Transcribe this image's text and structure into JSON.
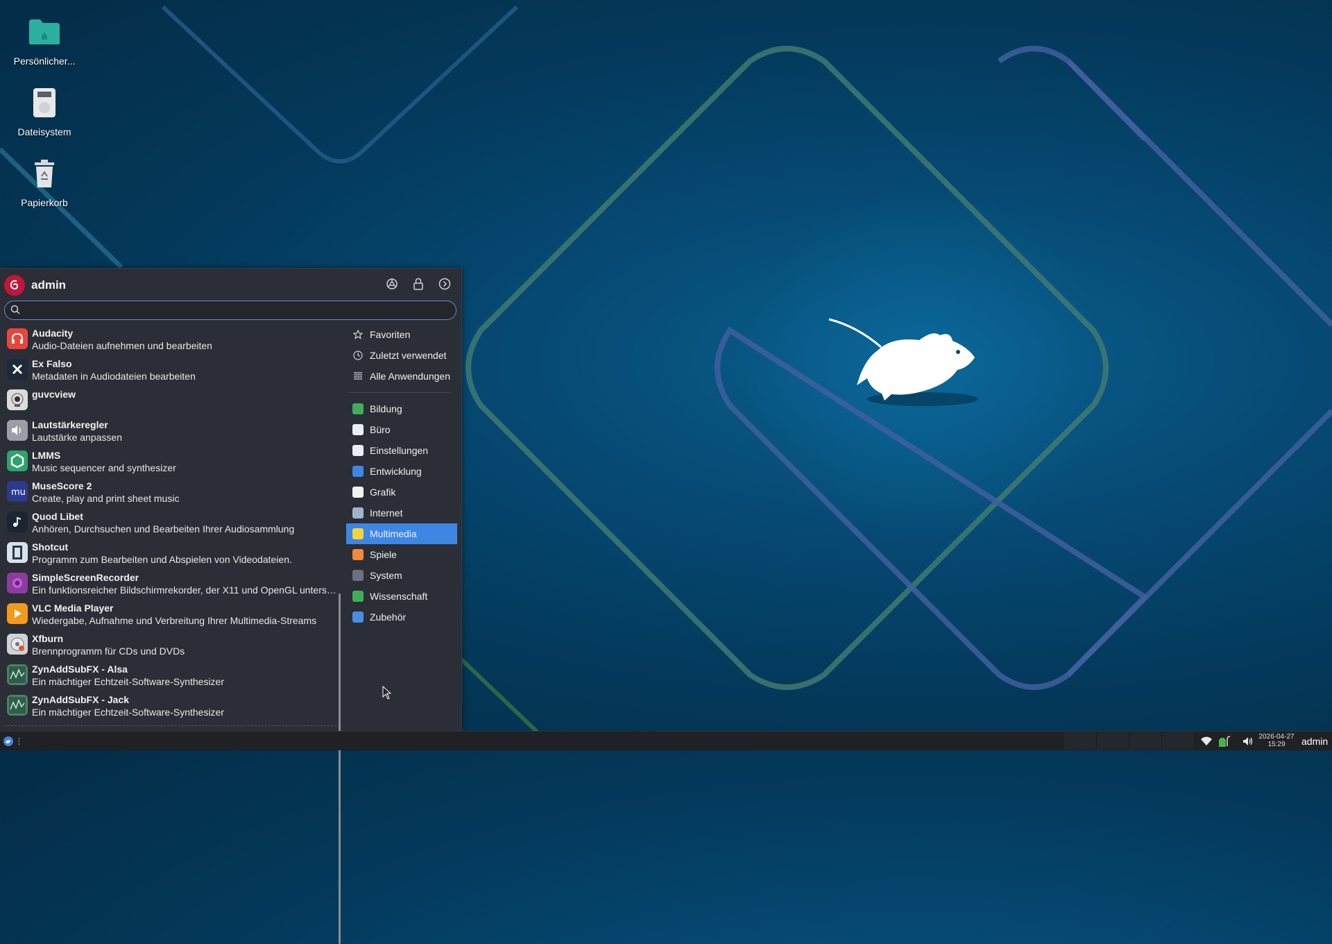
{
  "desktop": {
    "icons": [
      {
        "label": "Persönlicher..."
      },
      {
        "label": "Dateisystem"
      },
      {
        "label": "Papierkorb"
      }
    ]
  },
  "menu": {
    "username": "admin",
    "search_value": "",
    "apps": [
      {
        "name": "Audacity",
        "desc": "Audio-Dateien aufnehmen und bearbeiten",
        "icon": "headphones-icon",
        "color": "#e8463c"
      },
      {
        "name": "Ex Falso",
        "desc": "Metadaten in Audiodateien bearbeiten",
        "icon": "tag-icon",
        "color": "#1d2a3a"
      },
      {
        "name": "guvcview",
        "desc": "",
        "icon": "webcam-icon",
        "color": "#dcdcdc"
      },
      {
        "name": "Lautstärkeregler",
        "desc": "Lautstärke anpassen",
        "icon": "speaker-icon",
        "color": "#9a9ea6"
      },
      {
        "name": "LMMS",
        "desc": "Music sequencer and synthesizer",
        "icon": "lmms-icon",
        "color": "#2ea36b"
      },
      {
        "name": "MuseScore 2",
        "desc": "Create, play and print sheet music",
        "icon": "musescore-icon",
        "color": "#2b3a8c"
      },
      {
        "name": "Quod Libet",
        "desc": "Anhören, Durchsuchen und Bearbeiten Ihrer Audiosammlung",
        "icon": "music-note-icon",
        "color": "#1c2532"
      },
      {
        "name": "Shotcut",
        "desc": "Programm zum Bearbeiten und Abspielen von Videodateien.",
        "icon": "film-icon",
        "color": "#d8e2ea"
      },
      {
        "name": "SimpleScreenRecorder",
        "desc": "Ein funktionsreicher Bildschirmrekorder, der X11 und OpenGL unterst...",
        "icon": "record-icon",
        "color": "#8b3d9e"
      },
      {
        "name": "VLC Media Player",
        "desc": "Wiedergabe, Aufnahme und Verbreitung Ihrer Multimedia-Streams",
        "icon": "play-icon",
        "color": "#f29a1c"
      },
      {
        "name": "Xfburn",
        "desc": "Brennprogramm für CDs und DVDs",
        "icon": "disc-burn-icon",
        "color": "#cfd3d8"
      },
      {
        "name": "ZynAddSubFX - Alsa",
        "desc": "Ein mächtiger Echtzeit-Software-Synthesizer",
        "icon": "synth-icon",
        "color": "#4f7f6a"
      },
      {
        "name": "ZynAddSubFX - Jack",
        "desc": "Ein mächtiger Echtzeit-Software-Synthesizer",
        "icon": "synth-icon",
        "color": "#4f7f6a"
      }
    ],
    "top_categories": [
      {
        "label": "Favoriten",
        "icon": "star-icon"
      },
      {
        "label": "Zuletzt verwendet",
        "icon": "clock-icon"
      },
      {
        "label": "Alle Anwendungen",
        "icon": "list-icon"
      }
    ],
    "categories": [
      {
        "label": "Bildung",
        "icon": "education-icon",
        "color": "#3fae5a"
      },
      {
        "label": "Büro",
        "icon": "office-icon",
        "color": "#e9eef6"
      },
      {
        "label": "Einstellungen",
        "icon": "settings-icon",
        "color": "#e9eef6"
      },
      {
        "label": "Entwicklung",
        "icon": "development-icon",
        "color": "#3d86e4"
      },
      {
        "label": "Grafik",
        "icon": "graphics-icon",
        "color": "#f2f2f2"
      },
      {
        "label": "Internet",
        "icon": "internet-icon",
        "color": "#9fb4cc"
      },
      {
        "label": "Multimedia",
        "icon": "multimedia-icon",
        "color": "#f5d33b",
        "active": true
      },
      {
        "label": "Spiele",
        "icon": "games-icon",
        "color": "#f08a3c"
      },
      {
        "label": "System",
        "icon": "system-icon",
        "color": "#6a7080"
      },
      {
        "label": "Wissenschaft",
        "icon": "science-icon",
        "color": "#3fae5a"
      },
      {
        "label": "Zubehör",
        "icon": "accessories-icon",
        "color": "#4b8de0"
      }
    ]
  },
  "panel": {
    "clock_date": "2026-04-27",
    "clock_time": "15:29",
    "user": "admin"
  },
  "colors": {
    "accent": "#3d86e4",
    "menu_bg": "#2b2e36",
    "panel_bg": "#1f2125"
  }
}
